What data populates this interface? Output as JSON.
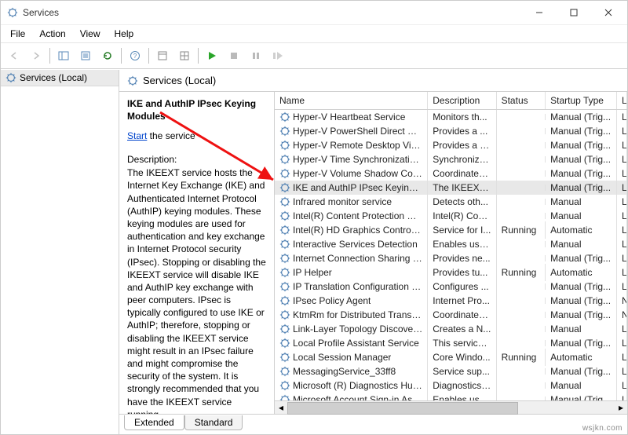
{
  "window": {
    "title": "Services"
  },
  "menu": {
    "file": "File",
    "action": "Action",
    "view": "View",
    "help": "Help"
  },
  "left": {
    "node": "Services (Local)"
  },
  "header": {
    "title": "Services (Local)"
  },
  "detail": {
    "title": "IKE and AuthIP IPsec Keying Modules",
    "start_label": "Start",
    "start_suffix": " the service",
    "desc_label": "Description:",
    "desc_text": "The IKEEXT service hosts the Internet Key Exchange (IKE) and Authenticated Internet Protocol (AuthIP) keying modules. These keying modules are used for authentication and key exchange in Internet Protocol security (IPsec). Stopping or disabling the IKEEXT service will disable IKE and AuthIP key exchange with peer computers. IPsec is typically configured to use IKE or AuthIP; therefore, stopping or disabling the IKEEXT service might result in an IPsec failure and might compromise the security of the system. It is strongly recommended that you have the IKEEXT service running."
  },
  "columns": {
    "name": "Name",
    "description": "Description",
    "status": "Status",
    "startup": "Startup Type",
    "logon": "Log"
  },
  "services": [
    {
      "name": "Hyper-V Heartbeat Service",
      "desc": "Monitors th...",
      "status": "",
      "startup": "Manual (Trig...",
      "log": "Loc"
    },
    {
      "name": "Hyper-V PowerShell Direct Service",
      "desc": "Provides a ...",
      "status": "",
      "startup": "Manual (Trig...",
      "log": "Loc"
    },
    {
      "name": "Hyper-V Remote Desktop Virtualiz...",
      "desc": "Provides a p...",
      "status": "",
      "startup": "Manual (Trig...",
      "log": "Loc"
    },
    {
      "name": "Hyper-V Time Synchronization Ser...",
      "desc": "Synchronize...",
      "status": "",
      "startup": "Manual (Trig...",
      "log": "Loc"
    },
    {
      "name": "Hyper-V Volume Shadow Copy Re...",
      "desc": "Coordinates...",
      "status": "",
      "startup": "Manual (Trig...",
      "log": "Loc"
    },
    {
      "name": "IKE and AuthIP IPsec Keying Modu...",
      "desc": "The IKEEXT ...",
      "status": "",
      "startup": "Manual (Trig...",
      "log": "Loc",
      "selected": true
    },
    {
      "name": "Infrared monitor service",
      "desc": "Detects oth...",
      "status": "",
      "startup": "Manual",
      "log": "Loc"
    },
    {
      "name": "Intel(R) Content Protection HECI S...",
      "desc": "Intel(R) Con...",
      "status": "",
      "startup": "Manual",
      "log": "Loc"
    },
    {
      "name": "Intel(R) HD Graphics Control Panel...",
      "desc": "Service for I...",
      "status": "Running",
      "startup": "Automatic",
      "log": "Loc"
    },
    {
      "name": "Interactive Services Detection",
      "desc": "Enables use...",
      "status": "",
      "startup": "Manual",
      "log": "Loc"
    },
    {
      "name": "Internet Connection Sharing (ICS)",
      "desc": "Provides ne...",
      "status": "",
      "startup": "Manual (Trig...",
      "log": "Loc"
    },
    {
      "name": "IP Helper",
      "desc": "Provides tu...",
      "status": "Running",
      "startup": "Automatic",
      "log": "Loc"
    },
    {
      "name": "IP Translation Configuration Service",
      "desc": "Configures ...",
      "status": "",
      "startup": "Manual (Trig...",
      "log": "Loc"
    },
    {
      "name": "IPsec Policy Agent",
      "desc": "Internet Pro...",
      "status": "",
      "startup": "Manual (Trig...",
      "log": "Net"
    },
    {
      "name": "KtmRm for Distributed Transaction...",
      "desc": "Coordinates...",
      "status": "",
      "startup": "Manual (Trig...",
      "log": "Net"
    },
    {
      "name": "Link-Layer Topology Discovery Ma...",
      "desc": "Creates a N...",
      "status": "",
      "startup": "Manual",
      "log": "Loc"
    },
    {
      "name": "Local Profile Assistant Service",
      "desc": "This service ...",
      "status": "",
      "startup": "Manual (Trig...",
      "log": "Loc"
    },
    {
      "name": "Local Session Manager",
      "desc": "Core Windo...",
      "status": "Running",
      "startup": "Automatic",
      "log": "Loc"
    },
    {
      "name": "MessagingService_33ff8",
      "desc": "Service sup...",
      "status": "",
      "startup": "Manual (Trig...",
      "log": "Loc"
    },
    {
      "name": "Microsoft (R) Diagnostics Hub Sta...",
      "desc": "Diagnostics ...",
      "status": "",
      "startup": "Manual",
      "log": "Loc"
    },
    {
      "name": "Microsoft Account Sign-in Assistant",
      "desc": "Enables use...",
      "status": "",
      "startup": "Manual (Trig...",
      "log": "Loc"
    }
  ],
  "tabs": {
    "extended": "Extended",
    "standard": "Standard"
  },
  "watermark": "wsjkn.com"
}
